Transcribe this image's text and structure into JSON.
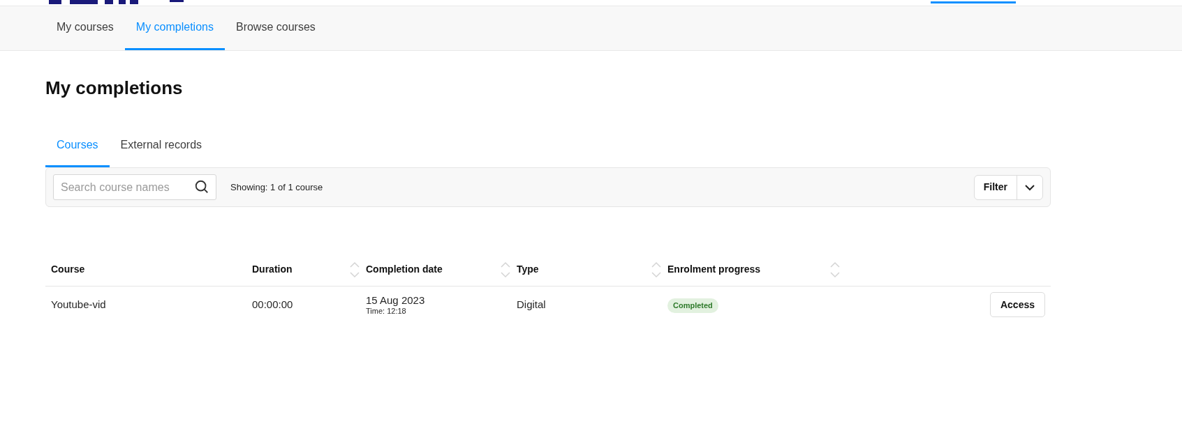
{
  "nav": {
    "items": [
      {
        "label": "My courses",
        "selected": false
      },
      {
        "label": "My completions",
        "selected": true
      },
      {
        "label": "Browse courses",
        "selected": false
      }
    ]
  },
  "page": {
    "title": "My completions"
  },
  "tabs": [
    {
      "label": "Courses",
      "selected": true
    },
    {
      "label": "External records",
      "selected": false
    }
  ],
  "toolbar": {
    "search": {
      "placeholder": "Search course names"
    },
    "count": "Showing: 1 of 1 course",
    "filter": "Filter"
  },
  "table": {
    "columns": [
      {
        "label": "Course",
        "sortable": false
      },
      {
        "label": "Duration",
        "sortable": true
      },
      {
        "label": "Completion date",
        "sortable": true
      },
      {
        "label": "Type",
        "sortable": true
      },
      {
        "label": "Enrolment progress",
        "sortable": true
      }
    ],
    "rows": [
      {
        "course": "Youtube-vid",
        "duration": "00:00:00",
        "date": "15 Aug 2023",
        "time": "Time: 12:18",
        "type": "Digital",
        "progress": "Completed",
        "action": "Access"
      }
    ]
  }
}
